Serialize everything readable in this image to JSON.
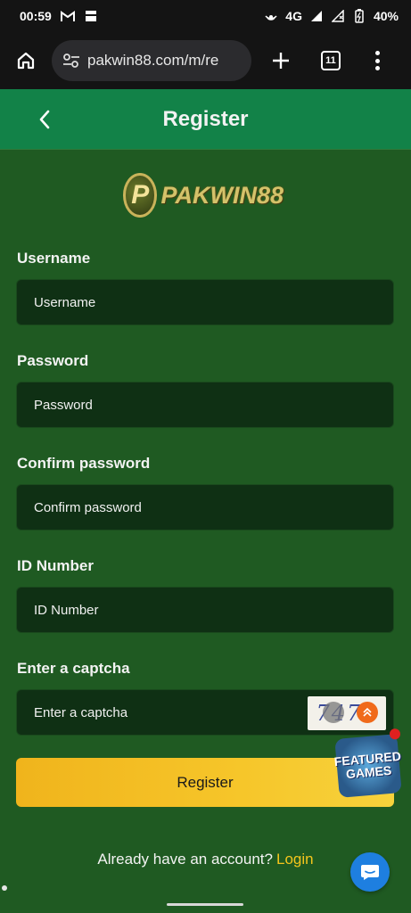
{
  "status_bar": {
    "time": "00:59",
    "network": "4G",
    "battery": "40%"
  },
  "browser": {
    "url": "pakwin88.com/m/re",
    "tab_count": "11"
  },
  "header": {
    "title": "Register"
  },
  "logo": {
    "mark": "P",
    "text": "PAKWIN88"
  },
  "form": {
    "username": {
      "label": "Username",
      "placeholder": "Username"
    },
    "password": {
      "label": "Password",
      "placeholder": "Password"
    },
    "confirm_password": {
      "label": "Confirm password",
      "placeholder": "Confirm password"
    },
    "id_number": {
      "label": "ID Number",
      "placeholder": "ID Number"
    },
    "captcha": {
      "label": "Enter a captcha",
      "placeholder": "Enter a captcha",
      "image_text": "7478"
    },
    "submit_label": "Register"
  },
  "footer": {
    "prompt": "Already have an account?",
    "login_label": "Login"
  },
  "featured": {
    "line1": "FEATURED",
    "line2": "GAMES"
  },
  "colors": {
    "page_bg": "#1f5a22",
    "header_bg": "#128248",
    "input_bg": "#0f3014",
    "accent_yellow": "#f6c62a",
    "login_link": "#f4c51c",
    "chat_blue": "#1e7fe0"
  }
}
